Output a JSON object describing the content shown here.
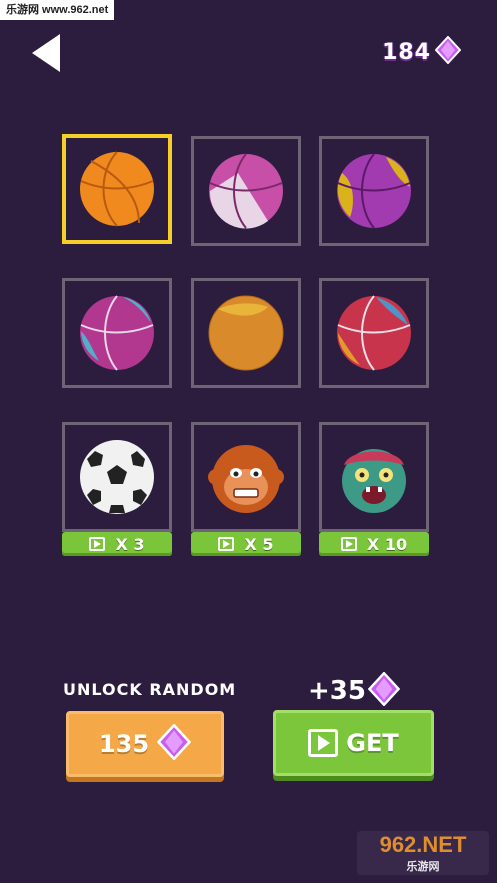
{
  "watermark_top": "乐游网 www.962.net",
  "header": {
    "gems": "184"
  },
  "grid": {
    "items": [
      {
        "name": "orange-basketball",
        "selected": true,
        "locked": false
      },
      {
        "name": "pink-white-basketball",
        "selected": false,
        "locked": false
      },
      {
        "name": "purple-yellow-basketball",
        "selected": false,
        "locked": false
      },
      {
        "name": "pink-blue-basketball",
        "selected": false,
        "locked": false
      },
      {
        "name": "orange-yellow-ball",
        "selected": false,
        "locked": false
      },
      {
        "name": "red-blue-basketball",
        "selected": false,
        "locked": false
      },
      {
        "name": "soccer-ball",
        "price": "X 3",
        "locked": true
      },
      {
        "name": "monkey-ball",
        "price": "X 5",
        "locked": true
      },
      {
        "name": "zombie-ball",
        "price": "X 10",
        "locked": true
      }
    ]
  },
  "unlock": {
    "label": "UNLOCK RANDOM",
    "cost": "135"
  },
  "reward": {
    "label": "+35",
    "button": "GET"
  },
  "watermark_logo": {
    "big": "962.NET",
    "small": "乐游网"
  },
  "colors": {
    "background": "#2c1d3f",
    "selected_border": "#f4cf29",
    "gem": "#c95df0",
    "green": "#7bc53a",
    "orange": "#f4a847"
  }
}
